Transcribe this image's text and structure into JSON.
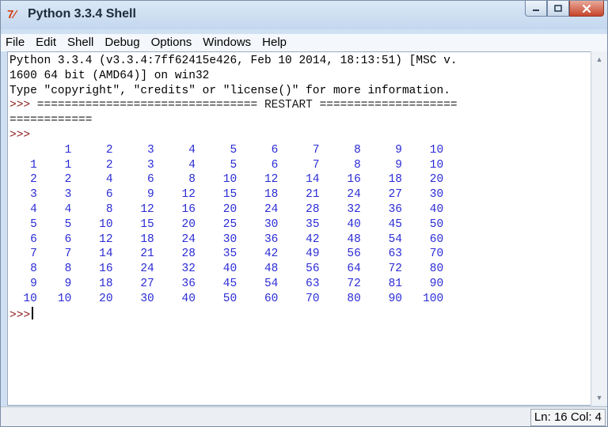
{
  "window": {
    "title": "Python 3.3.4 Shell",
    "icon_text": "7⁄",
    "icon_name": "python-idle-icon",
    "controls": {
      "minimize": "minimize-icon",
      "maximize": "maximize-icon",
      "close": "close-icon"
    }
  },
  "menubar": {
    "items": [
      "File",
      "Edit",
      "Shell",
      "Debug",
      "Options",
      "Windows",
      "Help"
    ]
  },
  "shell": {
    "banner_1": "Python 3.3.4 (v3.3.4:7ff62415e426, Feb 10 2014, 18:13:51) [MSC v.",
    "banner_2": "1600 64 bit (AMD64)] on win32",
    "banner_3": "Type \"copyright\", \"credits\" or \"license()\" for more information.",
    "prompt": ">>>",
    "restart_1": " ================================ RESTART ====================",
    "restart_2": "============",
    "table_rows": [
      "        1     2     3     4     5     6     7     8     9    10",
      "   1    1     2     3     4     5     6     7     8     9    10",
      "   2    2     4     6     8    10    12    14    16    18    20",
      "   3    3     6     9    12    15    18    21    24    27    30",
      "   4    4     8    12    16    20    24    28    32    36    40",
      "   5    5    10    15    20    25    30    35    40    45    50",
      "   6    6    12    18    24    30    36    42    48    54    60",
      "   7    7    14    21    28    35    42    49    56    63    70",
      "   8    8    16    24    32    40    48    56    64    72    80",
      "   9    9    18    27    36    45    54    63    72    81    90",
      "  10   10    20    30    40    50    60    70    80    90   100"
    ]
  },
  "status": {
    "line": "Ln: 16",
    "col": "Col: 4"
  },
  "colors": {
    "prompt": "#8b1a1a",
    "output": "#2b2bd6",
    "title_bar": "#c3d7ee",
    "close_button": "#c7452c"
  }
}
